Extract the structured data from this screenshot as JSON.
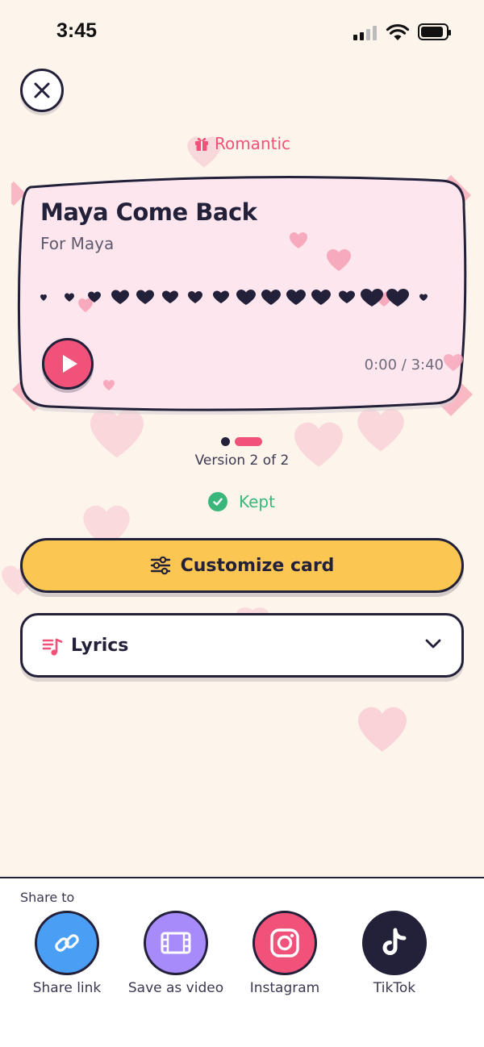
{
  "status_bar": {
    "time": "3:45"
  },
  "header": {
    "close_icon": "close-icon"
  },
  "song": {
    "mood": "Romantic",
    "mood_icon": "gift-icon",
    "title": "Maya Come Back",
    "subtitle": "For Maya",
    "time_display": "0:00 / 3:40",
    "playback_progress": 0
  },
  "versions": {
    "label": "Version 2 of 2",
    "count": 2,
    "current": 2
  },
  "kept": {
    "label": "Kept",
    "icon": "check-circle-icon"
  },
  "customize": {
    "label": "Customize card",
    "icon": "sliders-icon"
  },
  "lyrics": {
    "label": "Lyrics",
    "icon": "music-list-icon",
    "expand_icon": "chevron-down-icon"
  },
  "share": {
    "title": "Share to",
    "items": [
      {
        "label": "Share link",
        "icon": "link-icon",
        "color": "#4a9ff5"
      },
      {
        "label": "Save as video",
        "icon": "film-icon",
        "color": "#a78bfa"
      },
      {
        "label": "Instagram",
        "icon": "instagram-icon",
        "color": "#f0527a"
      },
      {
        "label": "TikTok",
        "icon": "tiktok-icon",
        "color": "#23203a"
      }
    ]
  },
  "colors": {
    "background": "#fdf5ec",
    "card": "#fde6ee",
    "accent_pink": "#f0527a",
    "accent_yellow": "#fcc653",
    "success_green": "#3bb67a",
    "ink": "#23203a"
  }
}
